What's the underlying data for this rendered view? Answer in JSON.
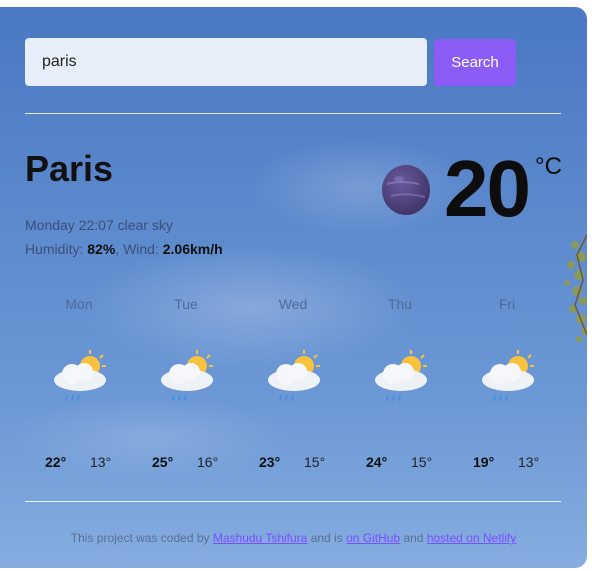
{
  "search": {
    "value": "paris",
    "button_label": "Search"
  },
  "current": {
    "city": "Paris",
    "datetime": "Monday 22:07",
    "description": "clear sky",
    "humidity_label": "Humidity:",
    "humidity_value": "82%",
    "wind_label": "Wind:",
    "wind_value": "2.06km/h",
    "temperature": "20",
    "unit": "°C",
    "icon": "moon-icon"
  },
  "forecast": [
    {
      "day": "Mon",
      "high": "22°",
      "low": "13°",
      "icon": "partly-cloudy-rain-icon"
    },
    {
      "day": "Tue",
      "high": "25°",
      "low": "16°",
      "icon": "partly-cloudy-rain-icon"
    },
    {
      "day": "Wed",
      "high": "23°",
      "low": "15°",
      "icon": "partly-cloudy-rain-icon"
    },
    {
      "day": "Thu",
      "high": "24°",
      "low": "15°",
      "icon": "partly-cloudy-rain-icon"
    },
    {
      "day": "Fri",
      "high": "19°",
      "low": "13°",
      "icon": "partly-cloudy-rain-icon"
    }
  ],
  "footer": {
    "text1": "This project was coded by",
    "link1": "Mashudu Tshifura",
    "text2": "and is",
    "link2": "on GitHub",
    "text3": "and",
    "link3": "hosted on Netlify"
  },
  "colors": {
    "button": "#8b5cf6",
    "link": "#7c4dff",
    "sky": "#5b88cc"
  }
}
